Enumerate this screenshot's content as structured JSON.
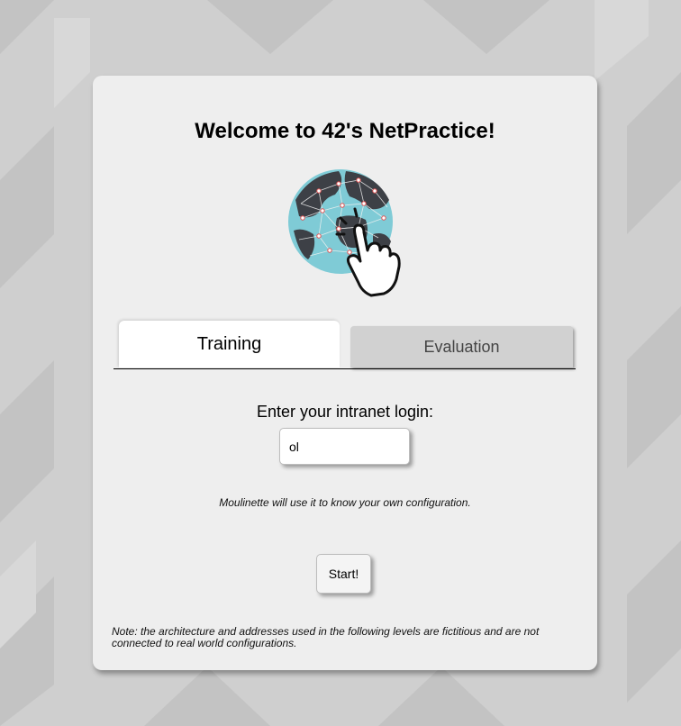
{
  "page": {
    "title": "Welcome to 42's NetPractice!",
    "logo_icon": "globe-touch-icon"
  },
  "tabs": [
    {
      "label": "Training",
      "active": true
    },
    {
      "label": "Evaluation",
      "active": false
    }
  ],
  "login": {
    "label": "Enter your intranet login:",
    "value": "ol",
    "hint": "Moulinette will use it to know your own configuration."
  },
  "start_button": {
    "label": "Start!"
  },
  "note": "Note: the architecture and addresses used in the following levels are fictitious and are not connected to real world configurations.",
  "colors": {
    "background": "#cfcfcf",
    "card": "#eeeeee",
    "active_tab": "#ffffff",
    "inactive_tab": "#d1d1d1",
    "globe_ocean": "#7fcbd6",
    "globe_land": "#3d4046"
  }
}
